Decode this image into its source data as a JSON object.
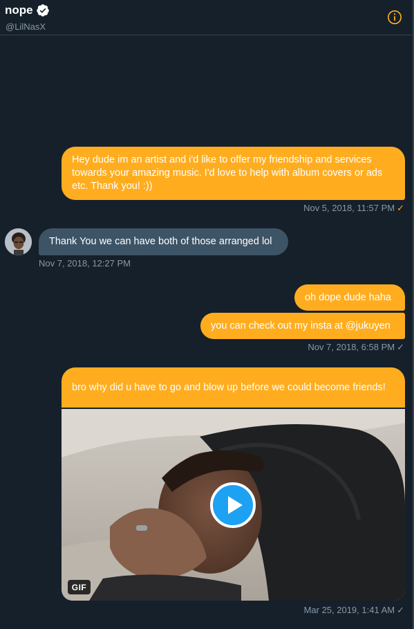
{
  "header": {
    "name": "nope",
    "handle": "@LilNasX"
  },
  "messages": [
    {
      "id": "m1",
      "direction": "sent",
      "text": "Hey dude im an artist and i'd like to offer my friendship and services towards your amazing music. I'd love to help with album covers or ads etc. Thank you! :))",
      "timestamp": "Nov 5, 2018, 11:57 PM",
      "status": "seen"
    },
    {
      "id": "m2",
      "direction": "received",
      "text": "Thank You we can have both of those arranged lol",
      "timestamp": "Nov 7, 2018, 12:27 PM"
    },
    {
      "id": "m3",
      "direction": "sent",
      "text": "oh dope dude haha"
    },
    {
      "id": "m4",
      "direction": "sent",
      "text": "you can check out my insta at @jukuyen",
      "timestamp": "Nov 7, 2018, 6:58 PM",
      "status": "sent"
    },
    {
      "id": "m5",
      "direction": "sent",
      "text": "bro why did u have to go and blow up before we could become friends!",
      "media_badge": "GIF",
      "timestamp": "Mar 25, 2019, 1:41 AM",
      "status": "sent"
    }
  ],
  "icons": {
    "verified": "verified-badge-icon",
    "info": "info-icon",
    "check": "✓",
    "play": "play-icon"
  },
  "colors": {
    "background": "#15202b",
    "sent_bubble": "#ffad1f",
    "received_bubble": "#3d5466",
    "muted_text": "#8899a6",
    "divider": "#38444d",
    "play_button": "#1da1f2"
  }
}
